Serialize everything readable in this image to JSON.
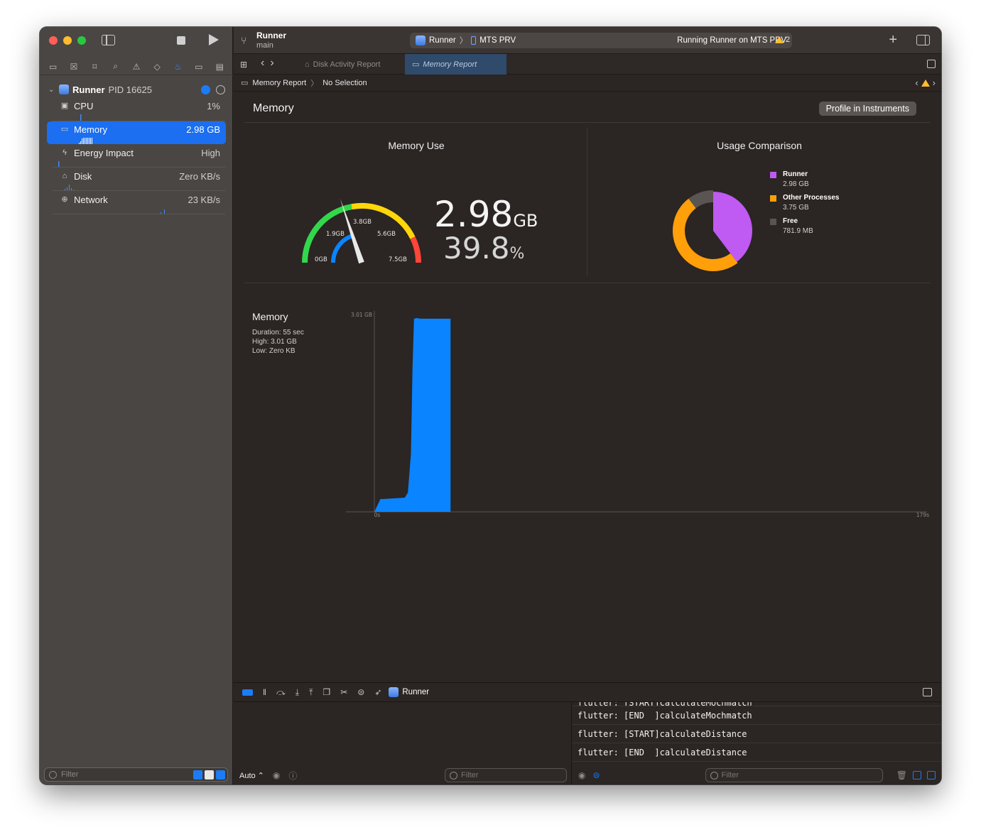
{
  "toolbar": {
    "project_name": "Runner",
    "branch": "main",
    "scheme": "Runner",
    "destination": "MTS PRV",
    "status": "Running Runner on MTS PRV",
    "warning_count": "2"
  },
  "tabs": [
    {
      "label": "Disk Activity Report",
      "active": false
    },
    {
      "label": "Memory Report",
      "active": true
    }
  ],
  "jumpbar": {
    "items": [
      "Memory Report",
      "No Selection"
    ]
  },
  "sidebar": {
    "process": {
      "name": "Runner",
      "pid": "PID 16625"
    },
    "gauges": [
      {
        "label": "CPU",
        "value": "1%",
        "icon": "cpu-icon"
      },
      {
        "label": "Memory",
        "value": "2.98 GB",
        "icon": "memory-icon",
        "selected": true
      },
      {
        "label": "Energy Impact",
        "value": "High",
        "icon": "bolt-icon"
      },
      {
        "label": "Disk",
        "value": "Zero KB/s",
        "icon": "disk-icon"
      },
      {
        "label": "Network",
        "value": "23 KB/s",
        "icon": "globe-icon"
      }
    ],
    "filter_placeholder": "Filter"
  },
  "report": {
    "title": "Memory",
    "profile_button": "Profile in Instruments",
    "memory_use_title": "Memory Use",
    "usage_title": "Usage Comparison",
    "gauge_labels": [
      "0GB",
      "1.9GB",
      "3.8GB",
      "5.6GB",
      "7.5GB"
    ],
    "gauge_value_gb": 2.98,
    "gauge_max_gb": 7.5,
    "used_value": "2.98",
    "used_unit": "GB",
    "percent_value": "39.8",
    "percent_unit": "%",
    "legend": [
      {
        "name": "Runner",
        "value": "2.98 GB",
        "color": "#bf5af2"
      },
      {
        "name": "Other Processes",
        "value": "3.75 GB",
        "color": "#ff9f0a"
      },
      {
        "name": "Free",
        "value": "781.9 MB",
        "color": "#5a5452"
      }
    ],
    "timeline": {
      "title": "Memory",
      "duration": "Duration: 55 sec",
      "high": "High: 3.01 GB",
      "low": "Low: Zero KB"
    }
  },
  "chart_data": [
    {
      "type": "pie",
      "title": "Usage Comparison",
      "categories": [
        "Runner",
        "Other Processes",
        "Free"
      ],
      "values": [
        2.98,
        3.75,
        0.7819
      ],
      "unit": "GB"
    },
    {
      "type": "area",
      "title": "Memory",
      "ylabel": "3.01 GB",
      "x_tick_labels": [
        "0s",
        "179s"
      ],
      "xlim": [
        0,
        179
      ],
      "ylim": [
        0,
        3.01
      ],
      "x": [
        0,
        2,
        3,
        10,
        11,
        12,
        12.5,
        13,
        14,
        15,
        20,
        25
      ],
      "values": [
        0,
        0.2,
        0.2,
        0.22,
        0.3,
        0.9,
        2.2,
        3.0,
        3.01,
        3.0,
        3.0,
        3.0
      ],
      "color": "#0a84ff"
    }
  ],
  "debug": {
    "process_name": "Runner",
    "auto_label": "Auto ⌃",
    "filter_placeholder": "Filter",
    "console_cut_line": "flutter: [START]calculateMochmatch",
    "console_lines": [
      "flutter: [END  ]calculateMochmatch",
      "flutter: [START]calculateDistance",
      "flutter: [END  ]calculateDistance"
    ]
  },
  "colors": {
    "accent": "#1b7cf5",
    "gauge_green": "#32d74b",
    "gauge_yellow": "#ffd60a",
    "gauge_red": "#ff453a",
    "gauge_blue": "#0a84ff"
  }
}
